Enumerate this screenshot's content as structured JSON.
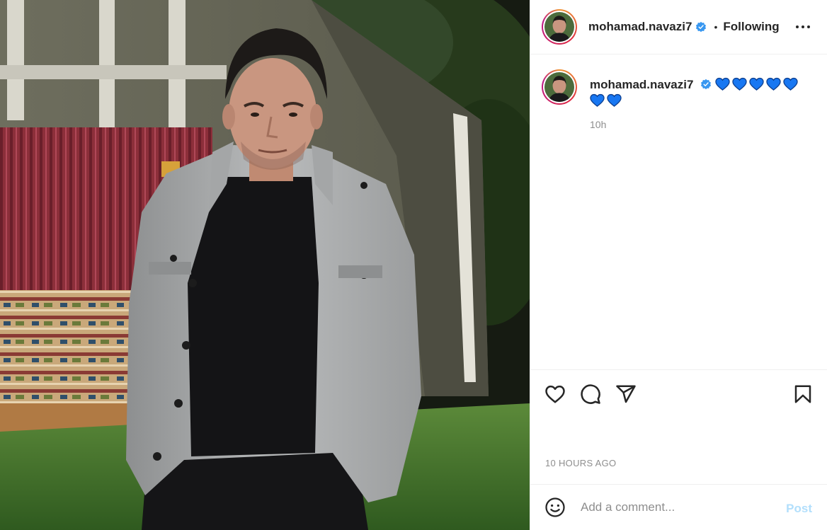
{
  "post": {
    "username": "mohamad.navazi7",
    "verified": true,
    "follow_separator": "•",
    "follow_status": "Following",
    "caption": {
      "username": "mohamad.navazi7",
      "emoji_text": "💙💙💙💙💙💙💙",
      "heart_count": 7,
      "heart_color": "#1877f2",
      "time": "10h"
    },
    "timestamp": "10 HOURS AGO",
    "icons": [
      "more-icon",
      "heart-icon",
      "comment-icon",
      "share-icon",
      "bookmark-icon",
      "emoji-icon",
      "verified-badge-icon"
    ]
  },
  "comment_box": {
    "placeholder": "Add a comment...",
    "post_label": "Post"
  },
  "colors": {
    "verified_blue": "#3897f0",
    "post_button_disabled": "#b2dffc",
    "secondary_text": "#8e8e8e"
  }
}
